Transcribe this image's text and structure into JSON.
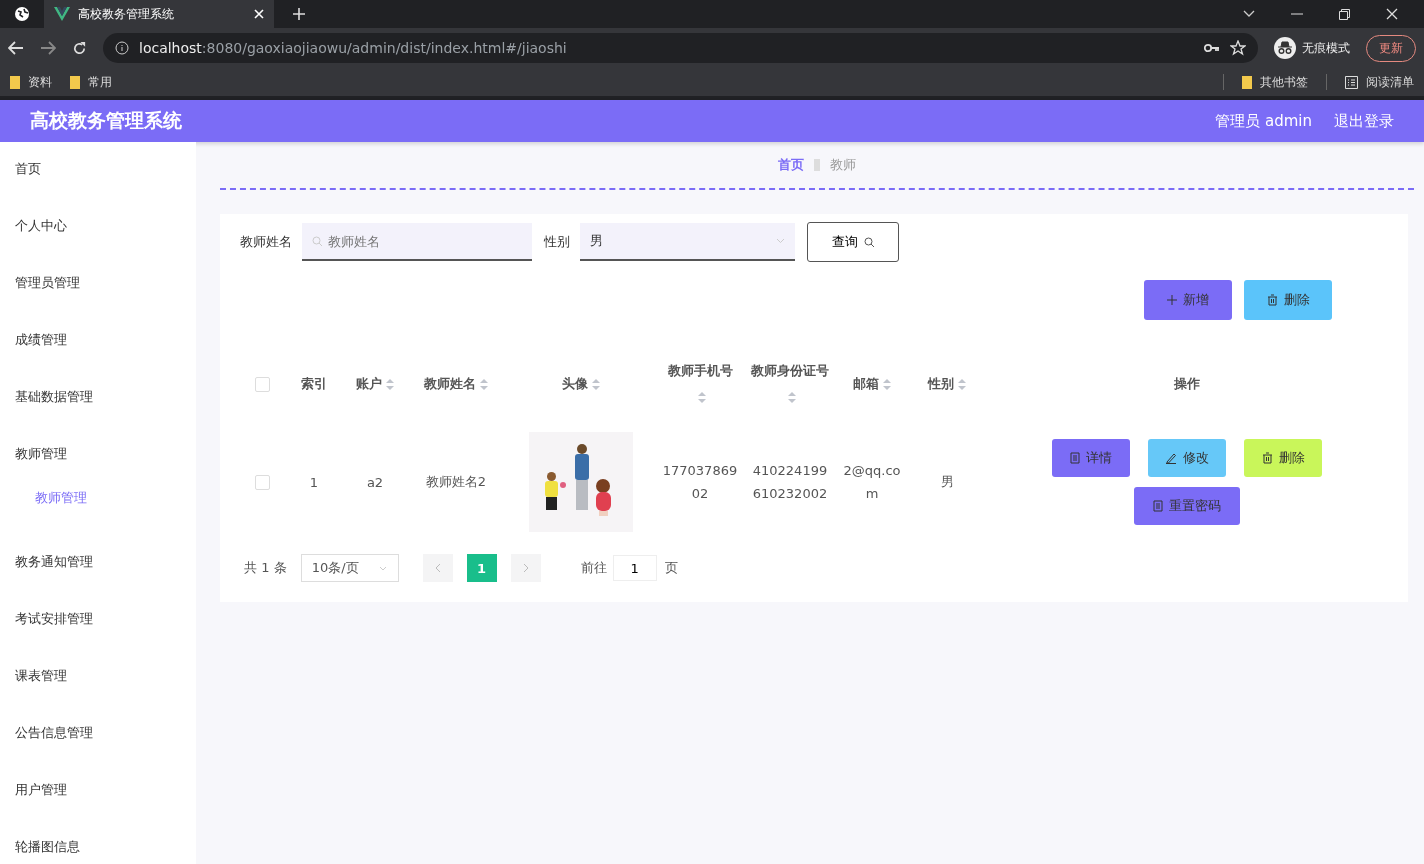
{
  "browser": {
    "tab_title": "高校教务管理系统",
    "url_host": "localhost",
    "url_rest": ":8080/gaoxiaojiaowu/admin/dist/index.html#/jiaoshi",
    "incognito_label": "无痕模式",
    "update_label": "更新",
    "bookmarks": [
      "资料",
      "常用"
    ],
    "other_bookmarks": "其他书签",
    "reading_list": "阅读清单"
  },
  "header": {
    "title": "高校教务管理系统",
    "user": "管理员 admin",
    "logout": "退出登录"
  },
  "sidebar": {
    "items": [
      {
        "label": "首页",
        "expanded": false
      },
      {
        "label": "个人中心",
        "expanded": false
      },
      {
        "label": "管理员管理",
        "expanded": false
      },
      {
        "label": "成绩管理",
        "expanded": false
      },
      {
        "label": "基础数据管理",
        "expanded": false
      },
      {
        "label": "教师管理",
        "expanded": true,
        "children": [
          {
            "label": "教师管理",
            "selected": true
          }
        ]
      },
      {
        "label": "教务通知管理",
        "expanded": false
      },
      {
        "label": "考试安排管理",
        "expanded": false
      },
      {
        "label": "课表管理",
        "expanded": false
      },
      {
        "label": "公告信息管理",
        "expanded": false
      },
      {
        "label": "用户管理",
        "expanded": false
      },
      {
        "label": "轮播图信息",
        "expanded": false
      }
    ]
  },
  "breadcrumb": [
    "首页",
    "教师"
  ],
  "search": {
    "name_label": "教师姓名",
    "name_placeholder": "教师姓名",
    "gender_label": "性别",
    "gender_value": "男",
    "query_button": "查询"
  },
  "actions": [
    {
      "kind": "add",
      "label": "新增"
    },
    {
      "kind": "delete",
      "label": "删除"
    }
  ],
  "table": {
    "header_checked": false,
    "columns": [
      {
        "label": "索引",
        "sortable": false
      },
      {
        "label": "账户",
        "sortable": true
      },
      {
        "label": "教师姓名",
        "sortable": true
      },
      {
        "label": "头像",
        "sortable": true
      },
      {
        "label": "教师手机号",
        "sortable": true
      },
      {
        "label": "教师身份证号",
        "sortable": true
      },
      {
        "label": "邮箱",
        "sortable": true
      },
      {
        "label": "性别",
        "sortable": true
      },
      {
        "label": "操作",
        "sortable": false
      }
    ],
    "rows": [
      {
        "checked": false,
        "index": "1",
        "account": "a2",
        "name": "教师姓名2",
        "phone": "17703786902",
        "id_number": "410224199610232002",
        "email": "2@qq.com",
        "gender": "男",
        "buttons": [
          {
            "kind": "detail",
            "label": "详情"
          },
          {
            "kind": "edit",
            "label": "修改"
          },
          {
            "kind": "delete",
            "label": "删除"
          },
          {
            "kind": "reset",
            "label": "重置密码"
          }
        ]
      }
    ]
  },
  "pagination": {
    "total": "共 1 条",
    "page_size": "10条/页",
    "pages": [
      {
        "label": "1",
        "selected": true
      }
    ],
    "goto_label": "前往",
    "goto_value": "1",
    "page_suffix": "页"
  }
}
